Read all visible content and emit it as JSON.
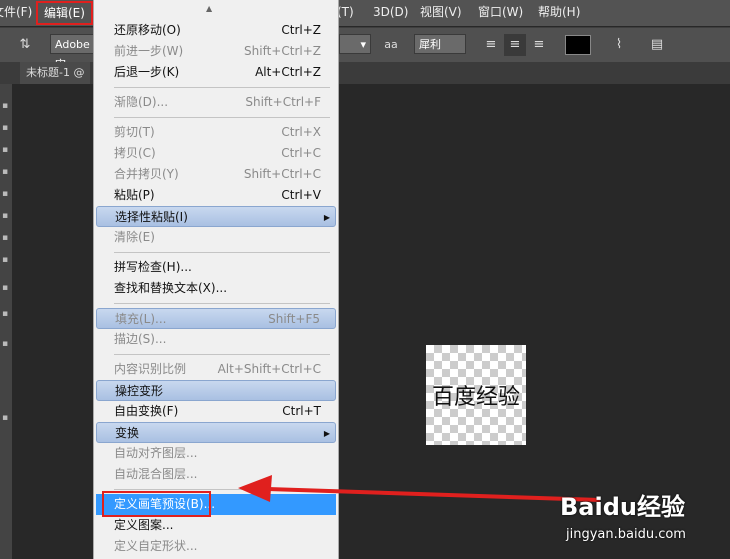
{
  "menubar": {
    "items": [
      {
        "label": "文件(F)"
      },
      {
        "label": "编辑(E)"
      },
      {
        "label": "(T)"
      },
      {
        "label": "3D(D)"
      },
      {
        "label": "视图(V)"
      },
      {
        "label": "窗口(W)"
      },
      {
        "label": "帮助(H)"
      }
    ]
  },
  "options": {
    "font_family": "Adobe 宋",
    "aa_icon": "aa",
    "antialias": "犀利",
    "size_dropdown": "▾"
  },
  "document": {
    "tab_label": "未标题-1 @"
  },
  "canvas": {
    "text": "百度经验"
  },
  "menu": {
    "items": [
      {
        "label": "还原移动(O)",
        "shortcut": "Ctrl+Z",
        "enabled": true
      },
      {
        "label": "前进一步(W)",
        "shortcut": "Shift+Ctrl+Z",
        "enabled": false
      },
      {
        "label": "后退一步(K)",
        "shortcut": "Alt+Ctrl+Z",
        "enabled": true
      },
      {
        "label": "渐隐(D)...",
        "shortcut": "Shift+Ctrl+F",
        "enabled": false
      },
      {
        "label": "剪切(T)",
        "shortcut": "Ctrl+X",
        "enabled": false
      },
      {
        "label": "拷贝(C)",
        "shortcut": "Ctrl+C",
        "enabled": false
      },
      {
        "label": "合并拷贝(Y)",
        "shortcut": "Shift+Ctrl+C",
        "enabled": false
      },
      {
        "label": "粘贴(P)",
        "shortcut": "Ctrl+V",
        "enabled": true
      },
      {
        "label": "选择性粘贴(I)",
        "shortcut": "",
        "enabled": true,
        "submenu": true
      },
      {
        "label": "清除(E)",
        "shortcut": "",
        "enabled": false
      },
      {
        "label": "拼写检查(H)...",
        "shortcut": "",
        "enabled": true
      },
      {
        "label": "查找和替换文本(X)...",
        "shortcut": "",
        "enabled": true
      },
      {
        "label": "填充(L)...",
        "shortcut": "Shift+F5",
        "enabled": false
      },
      {
        "label": "描边(S)...",
        "shortcut": "",
        "enabled": false
      },
      {
        "label": "内容识别比例",
        "shortcut": "Alt+Shift+Ctrl+C",
        "enabled": false
      },
      {
        "label": "操控变形",
        "shortcut": "",
        "enabled": true
      },
      {
        "label": "自由变换(F)",
        "shortcut": "Ctrl+T",
        "enabled": true
      },
      {
        "label": "变换",
        "shortcut": "",
        "enabled": true,
        "submenu": true
      },
      {
        "label": "自动对齐图层...",
        "shortcut": "",
        "enabled": false
      },
      {
        "label": "自动混合图层...",
        "shortcut": "",
        "enabled": false
      },
      {
        "label": "定义画笔预设(B)...",
        "shortcut": "",
        "enabled": true,
        "highlighted": true
      },
      {
        "label": "定义图案...",
        "shortcut": "",
        "enabled": true
      },
      {
        "label": "定义自定形状...",
        "shortcut": "",
        "enabled": false
      }
    ],
    "submenu_arrow": "▶",
    "scroll_up_arrow": "▲"
  },
  "watermark": {
    "logo": "Baidu经验",
    "url": "jingyan.baidu.com"
  },
  "colors": {
    "menubar_bg": "#535353",
    "canvas_bg": "#282828",
    "menu_bg": "#f0f0f0",
    "selection": "#3399ff",
    "annotation_red": "#e0201e"
  }
}
